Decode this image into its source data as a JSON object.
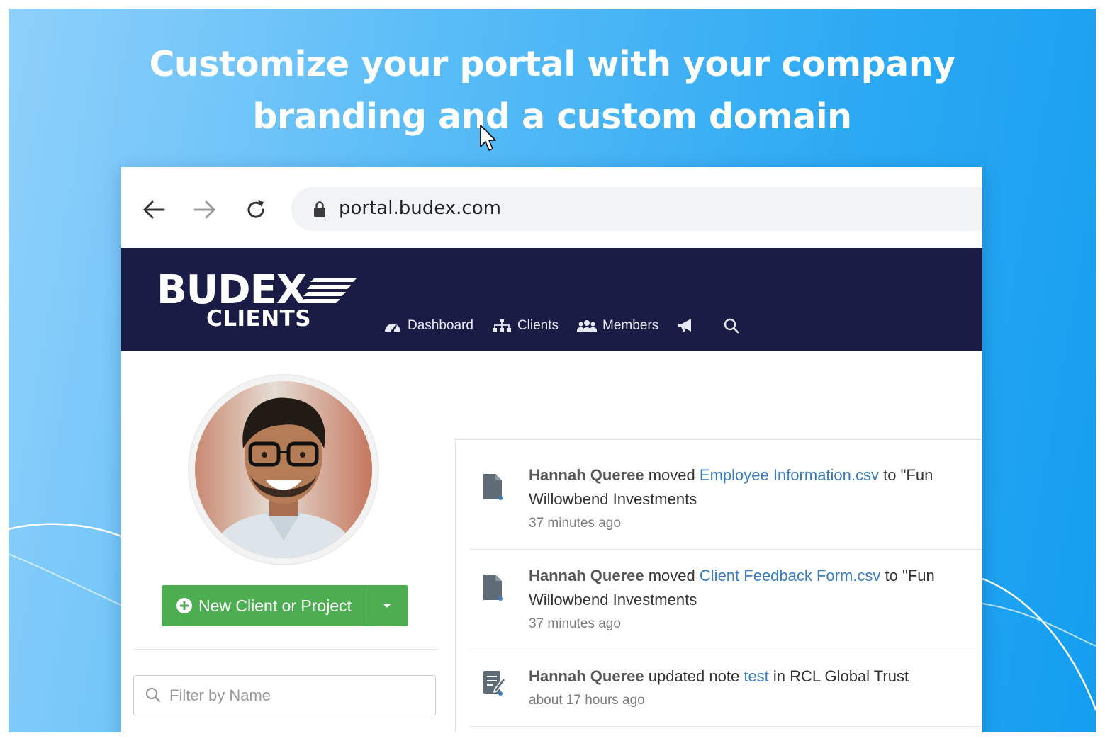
{
  "headline": {
    "line1": "Customize your portal with your company",
    "line2": "branding and a custom domain"
  },
  "browser": {
    "url": "portal.budex.com",
    "icons": [
      "back-arrow-icon",
      "forward-arrow-icon",
      "reload-icon",
      "lock-icon"
    ]
  },
  "app": {
    "logo_top": "BUDEX",
    "logo_bottom": "CLIENTS",
    "nav": [
      {
        "label": "Dashboard",
        "icon": "dashboard-gauge-icon"
      },
      {
        "label": "Clients",
        "icon": "sitemap-icon"
      },
      {
        "label": "Members",
        "icon": "users-icon"
      }
    ],
    "nav_icons": [
      "megaphone-icon",
      "search-icon"
    ],
    "header_color": "#1a1c45"
  },
  "sidebar": {
    "new_button_label": "New Client or Project",
    "new_button_color": "#4cae50",
    "filter_placeholder": "Filter by Name"
  },
  "feed": [
    {
      "user": "Hannah Queree",
      "action": "moved",
      "link": "Employee Information.csv",
      "rest": "to \"Fun",
      "line2": "Willowbend Investments",
      "time": "37 minutes ago",
      "icon": "file-icon"
    },
    {
      "user": "Hannah Queree",
      "action": "moved",
      "link": "Client Feedback Form.csv",
      "rest": "to \"Fun",
      "line2": "Willowbend Investments",
      "time": "37 minutes ago",
      "icon": "file-icon"
    },
    {
      "user": "Hannah Queree",
      "action": "updated note",
      "link": "test",
      "rest": "in RCL Global Trust",
      "time": "about 17 hours ago",
      "icon": "note-edit-icon"
    }
  ],
  "colors": {
    "background_start": "#8fd0fb",
    "background_end": "#149ef0",
    "link": "#3a7dbd"
  }
}
